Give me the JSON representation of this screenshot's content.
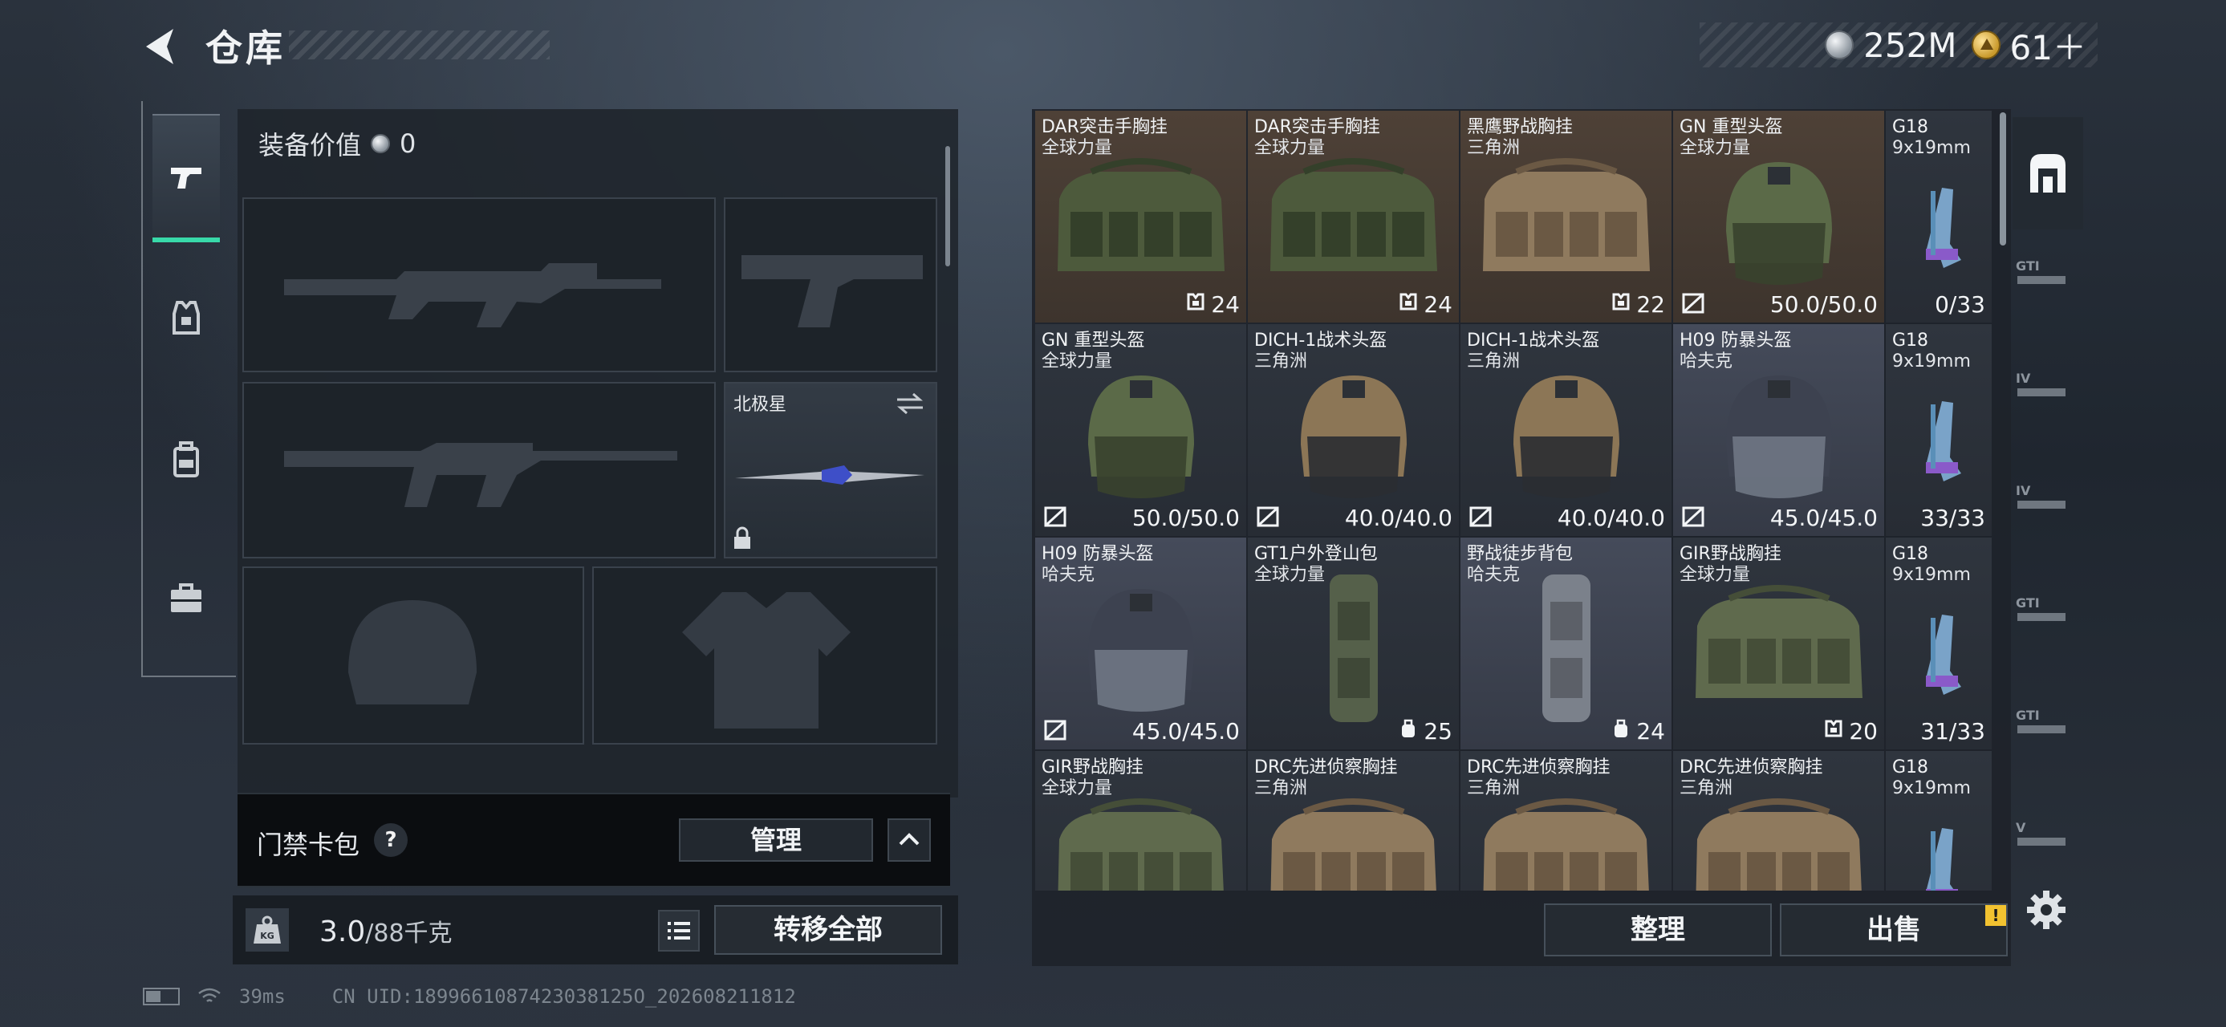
{
  "header": {
    "title": "仓库",
    "currencies": [
      {
        "icon": "silver-coin-icon",
        "value": "252M"
      },
      {
        "icon": "gold-triangle-coin-icon",
        "value": "61＋"
      }
    ]
  },
  "left_rail": {
    "items": [
      {
        "icon": "pistol-icon",
        "active": true
      },
      {
        "icon": "armor-vest-icon",
        "active": false
      },
      {
        "icon": "backpack-icon",
        "active": false
      },
      {
        "icon": "briefcase-icon",
        "active": false
      }
    ]
  },
  "equipment": {
    "value_label": "装备价值",
    "value": "0",
    "melee_name": "北极星"
  },
  "keycard": {
    "label": "门禁卡包",
    "help": "?",
    "manage_label": "管理"
  },
  "bottom": {
    "weight_current": "3.0",
    "weight_max": "/88千克",
    "kg_badge": "KG",
    "transfer_all_label": "转移全部"
  },
  "status": {
    "ping": "39ms",
    "uid": "CN UID:1899661087423038125O_202608211812"
  },
  "warehouse": {
    "items": [
      {
        "name": "DAR突击手胸挂",
        "sub": "全球力量",
        "art": "rig-green",
        "tone": "brown",
        "left_icon": "",
        "right_icon": "rig-capacity-icon",
        "right": "24"
      },
      {
        "name": "DAR突击手胸挂",
        "sub": "全球力量",
        "art": "rig-green",
        "tone": "brown",
        "left_icon": "",
        "right_icon": "rig-capacity-icon",
        "right": "24"
      },
      {
        "name": "黑鹰野战胸挂",
        "sub": "三角洲",
        "art": "rig-tan",
        "tone": "brown",
        "left_icon": "",
        "right_icon": "rig-capacity-icon",
        "right": "22"
      },
      {
        "name": "GN 重型头盔",
        "sub": "全球力量",
        "art": "helmet-green",
        "tone": "brown",
        "left_icon": "durability-icon",
        "right_icon": "",
        "right": "50.0/50.0"
      },
      {
        "name": "G18",
        "sub": "9x19mm",
        "art": "ammo",
        "tone": "dark",
        "narrow": true,
        "left_icon": "",
        "right_icon": "",
        "right": "0/33"
      },
      {
        "name": "GN 重型头盔",
        "sub": "全球力量",
        "art": "helmet-green",
        "tone": "dark",
        "left_icon": "durability-icon",
        "right_icon": "",
        "right": "50.0/50.0"
      },
      {
        "name": "DICH-1战术头盔",
        "sub": "三角洲",
        "art": "helmet-tan",
        "tone": "dark",
        "left_icon": "durability-icon",
        "right_icon": "",
        "right": "40.0/40.0"
      },
      {
        "name": "DICH-1战术头盔",
        "sub": "三角洲",
        "art": "helmet-tan",
        "tone": "dark",
        "left_icon": "durability-icon",
        "right_icon": "",
        "right": "40.0/40.0"
      },
      {
        "name": "H09 防暴头盔",
        "sub": "哈夫克",
        "art": "helmet-riot",
        "tone": "slate",
        "left_icon": "durability-icon",
        "right_icon": "",
        "right": "45.0/45.0"
      },
      {
        "name": "G18",
        "sub": "9x19mm",
        "art": "ammo",
        "tone": "dark",
        "narrow": true,
        "left_icon": "",
        "right_icon": "",
        "right": "33/33"
      },
      {
        "name": "H09 防暴头盔",
        "sub": "哈夫克",
        "art": "helmet-riot",
        "tone": "slate",
        "left_icon": "durability-icon",
        "right_icon": "",
        "right": "45.0/45.0"
      },
      {
        "name": "GT1户外登山包",
        "sub": "全球力量",
        "art": "pack-green",
        "tone": "dark",
        "left_icon": "",
        "right_icon": "bag-capacity-icon",
        "right": "25"
      },
      {
        "name": "野战徒步背包",
        "sub": "哈夫克",
        "art": "pack-gray",
        "tone": "slate",
        "left_icon": "",
        "right_icon": "bag-capacity-icon",
        "right": "24"
      },
      {
        "name": "GIR野战胸挂",
        "sub": "全球力量",
        "art": "rig-olive",
        "tone": "dark",
        "left_icon": "",
        "right_icon": "rig-capacity-icon",
        "right": "20"
      },
      {
        "name": "G18",
        "sub": "9x19mm",
        "art": "ammo",
        "tone": "dark",
        "narrow": true,
        "left_icon": "",
        "right_icon": "",
        "right": "31/33"
      },
      {
        "name": "GIR野战胸挂",
        "sub": "全球力量",
        "art": "rig-olive",
        "tone": "dark",
        "left_icon": "",
        "right_icon": "",
        "right": ""
      },
      {
        "name": "DRC先进侦察胸挂",
        "sub": "三角洲",
        "art": "rig-tan",
        "tone": "dark",
        "left_icon": "",
        "right_icon": "",
        "right": ""
      },
      {
        "name": "DRC先进侦察胸挂",
        "sub": "三角洲",
        "art": "rig-tan",
        "tone": "dark",
        "left_icon": "",
        "right_icon": "",
        "right": ""
      },
      {
        "name": "DRC先进侦察胸挂",
        "sub": "三角洲",
        "art": "rig-tan",
        "tone": "dark",
        "left_icon": "",
        "right_icon": "",
        "right": ""
      },
      {
        "name": "G18",
        "sub": "9x19mm",
        "art": "ammo",
        "tone": "dark",
        "narrow": true,
        "left_icon": "",
        "right_icon": "",
        "right": ""
      }
    ],
    "sort_label": "整理",
    "sell_label": "出售",
    "sell_badge": "!"
  },
  "tab_rail": {
    "tabs": [
      {
        "icon": "warehouse-home-icon",
        "label": "",
        "active": true
      },
      {
        "icon": "storage-tab-icon",
        "label": "GTI",
        "active": false
      },
      {
        "icon": "storage-tab-icon",
        "label": "IV",
        "active": false
      },
      {
        "icon": "storage-tab-icon",
        "label": "IV",
        "active": false
      },
      {
        "icon": "storage-tab-icon",
        "label": "GTI",
        "active": false
      },
      {
        "icon": "storage-tab-icon",
        "label": "GTI",
        "active": false
      },
      {
        "icon": "storage-tab-icon",
        "label": "V",
        "active": false
      }
    ],
    "settings_icon": "gear-icon"
  },
  "colors": {
    "accent": "#38d9a9",
    "warning": "#f2c230",
    "cell_brown": "#4e4137",
    "cell_slate": "#454b5a",
    "cell_dark": "#2f353e"
  }
}
